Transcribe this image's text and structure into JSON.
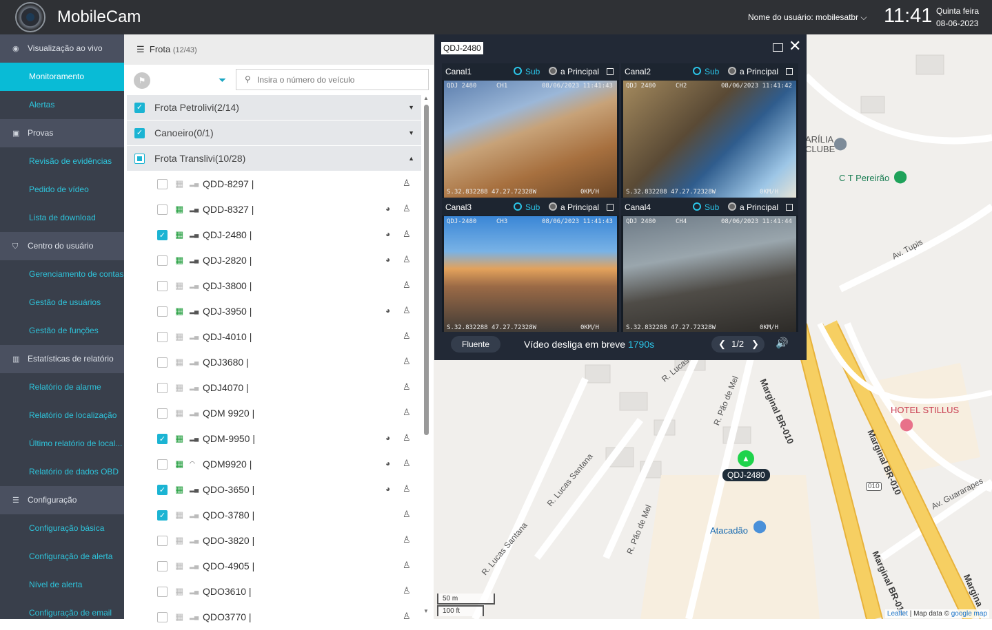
{
  "header": {
    "app_name": "MobileCam",
    "user_label": "Nome do usuário: mobilesatbr",
    "time": "11:41",
    "weekday": "Quinta feira",
    "date": "08-06-2023"
  },
  "sidebar": {
    "groups": [
      {
        "label": "Visualização ao vivo",
        "icon": "location-pin-icon",
        "items": [
          "Monitoramento",
          "Alertas"
        ]
      },
      {
        "label": "Provas",
        "icon": "briefcase-icon",
        "items": [
          "Revisão de evidências",
          "Pedido de vídeo",
          "Lista de download"
        ]
      },
      {
        "label": "Centro do usuário",
        "icon": "shield-icon",
        "items": [
          "Gerenciamento de contas",
          "Gestão de usuários",
          "Gestão de funções"
        ]
      },
      {
        "label": "Estatísticas de relatório",
        "icon": "bar-chart-icon",
        "items": [
          "Relatório de alarme",
          "Relatório de localização",
          "Último relatório de local...",
          "Relatório de dados OBD"
        ]
      },
      {
        "label": "Configuração",
        "icon": "sliders-icon",
        "items": [
          "Configuração básica",
          "Configuração de alerta",
          "Nível de alerta",
          "Configuração de email"
        ]
      }
    ],
    "active_item": "Monitoramento"
  },
  "fleet": {
    "title": "Frota",
    "count": "(12/43)",
    "search_placeholder": "Insira o número do veículo",
    "groups": [
      {
        "label": "Frota Petrolivi(2/14)",
        "state": "checked"
      },
      {
        "label": "Canoeiro(0/1)",
        "state": "checked"
      },
      {
        "label": "Frota Translivi(10/28)",
        "state": "partial"
      }
    ],
    "vehicles": [
      {
        "plate": "QDD-8297 |",
        "checked": false,
        "online": false,
        "signal": "4g"
      },
      {
        "plate": "QDD-8327 |",
        "checked": false,
        "online": true,
        "signal": "4g"
      },
      {
        "plate": "QDJ-2480 |",
        "checked": true,
        "online": true,
        "signal": "4g"
      },
      {
        "plate": "QDJ-2820 |",
        "checked": false,
        "online": true,
        "signal": "4g"
      },
      {
        "plate": "QDJ-3800 |",
        "checked": false,
        "online": false,
        "signal": "4g"
      },
      {
        "plate": "QDJ-3950 |",
        "checked": false,
        "online": true,
        "signal": "4g"
      },
      {
        "plate": "QDJ-4010 |",
        "checked": false,
        "online": false,
        "signal": "4g"
      },
      {
        "plate": "QDJ3680 |",
        "checked": false,
        "online": false,
        "signal": "4g"
      },
      {
        "plate": "QDJ4070 |",
        "checked": false,
        "online": false,
        "signal": "4g"
      },
      {
        "plate": "QDM 9920 |",
        "checked": false,
        "online": false,
        "signal": "4g"
      },
      {
        "plate": "QDM-9950 |",
        "checked": true,
        "online": true,
        "signal": "4g"
      },
      {
        "plate": "QDM9920 |",
        "checked": false,
        "online": true,
        "signal": "wifi"
      },
      {
        "plate": "QDO-3650 |",
        "checked": true,
        "online": true,
        "signal": "4g"
      },
      {
        "plate": "QDO-3780 |",
        "checked": true,
        "online": false,
        "signal": "4g"
      },
      {
        "plate": "QDO-3820 |",
        "checked": false,
        "online": false,
        "signal": "4g"
      },
      {
        "plate": "QDO-4905 |",
        "checked": false,
        "online": false,
        "signal": "4g"
      },
      {
        "plate": "QDO3610 |",
        "checked": false,
        "online": false,
        "signal": "4g"
      },
      {
        "plate": "QDO3770 |",
        "checked": false,
        "online": false,
        "signal": "4g"
      }
    ],
    "colors": {
      "accent": "#1bb4d3",
      "online": "#1e9c3a",
      "offline": "#bbbbbb"
    }
  },
  "video": {
    "title": "QDJ-2480",
    "sub_label": "Sub",
    "main_label": "a Principal",
    "channels": [
      {
        "name": "Canal1",
        "osd_plate": "QDJ 2480",
        "osd_ch": "CH1",
        "osd_time": "08/06/2023 11:41:43",
        "osd_gps": "S.32.832288 47.27.72328W",
        "osd_speed": "0KM/H"
      },
      {
        "name": "Canal2",
        "osd_plate": "QDJ 2480",
        "osd_ch": "CH2",
        "osd_time": "08/06/2023 11:41:42",
        "osd_gps": "S.32.832288 47.27.72328W",
        "osd_speed": "0KM/H"
      },
      {
        "name": "Canal3",
        "osd_plate": "QDJ-2480",
        "osd_ch": "CH3",
        "osd_time": "08/06/2023 11:41:43",
        "osd_gps": "S.32.832288 47.27.72328W",
        "osd_speed": "0KM/H"
      },
      {
        "name": "Canal4",
        "osd_plate": "QDJ 2480",
        "osd_ch": "CH4",
        "osd_time": "08/06/2023 11:41:44",
        "osd_gps": "S.32.832288 47.27.72328W",
        "osd_speed": "0KM/H"
      }
    ],
    "quality": "Fluente",
    "notice": "Vídeo desliga em breve",
    "countdown": "1790s",
    "page": "1/2"
  },
  "map": {
    "labels": {
      "arilia": "ARÍLIA\nCLUBE",
      "ct": "C T Pereirão",
      "tupis": "Av. Tupis",
      "hotel": "HOTEL STILLUS",
      "marginal1": "Marginal BR-010",
      "marginal2": "Marginal BR-010",
      "marginal3": "Marginal BR-010",
      "marginal4": "Margina",
      "br010": "010",
      "guararapes": "Av. Guararapes",
      "atacadao": "Atacadão",
      "lucas1": "R. Lucas",
      "lucas2": "R. Lucas Santana",
      "lucas3": "R. Lucas Santana",
      "paomel1": "R. Pão de Mel",
      "paomel2": "R. Pão de Mel"
    },
    "vehicle_tag": "QDJ-2480",
    "scale_m": "50 m",
    "scale_ft": "100 ft",
    "attribution_leaflet": "Leaflet",
    "attribution_text": " | Map data © ",
    "attribution_google": "google map"
  }
}
